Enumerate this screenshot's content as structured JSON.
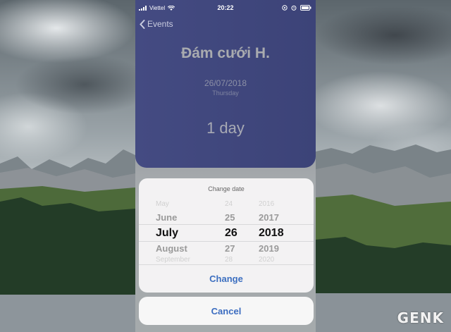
{
  "status_bar": {
    "carrier": "Viettel",
    "time": "20:22"
  },
  "nav": {
    "back_label": "Events"
  },
  "event": {
    "title": "Đám cưới H.",
    "date": "26/07/2018",
    "weekday": "Thursday",
    "countdown": "1 day"
  },
  "sheet": {
    "title": "Change date",
    "picker_rows": [
      {
        "month": "May",
        "day": "24",
        "year": "2016"
      },
      {
        "month": "June",
        "day": "25",
        "year": "2017"
      },
      {
        "month": "July",
        "day": "26",
        "year": "2018"
      },
      {
        "month": "August",
        "day": "27",
        "year": "2019"
      },
      {
        "month": "September",
        "day": "28",
        "year": "2020"
      }
    ],
    "selected_index": 2,
    "change_label": "Change",
    "cancel_label": "Cancel"
  },
  "watermark": {
    "text": "GENK"
  },
  "colors": {
    "card": "#3f467c",
    "action_blue": "#3c6fc0",
    "sheet_bg": "#f3f2f3"
  }
}
